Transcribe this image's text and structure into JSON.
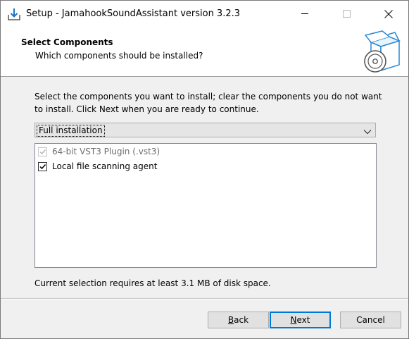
{
  "window": {
    "title": "Setup - JamahookSoundAssistant version 3.2.3",
    "icons": [
      "setup-download-icon",
      "minimize-icon",
      "maximize-icon",
      "close-icon"
    ]
  },
  "header": {
    "title": "Select Components",
    "subtitle": "Which components should be installed?",
    "icon": "software-box-disc-icon"
  },
  "body": {
    "description": "Select the components you want to install; clear the components you do not want to install. Click Next when you are ready to continue.",
    "install_type": {
      "selected": "Full installation"
    },
    "components": [
      {
        "label": "64-bit VST3 Plugin (.vst3)",
        "checked": true,
        "disabled": true
      },
      {
        "label": "Local file scanning agent",
        "checked": true,
        "disabled": false
      }
    ],
    "disk_space": "Current selection requires at least 3.1 MB of disk space."
  },
  "buttons": {
    "back_prefix": "",
    "back_access": "B",
    "back_rest": "ack",
    "next_access": "N",
    "next_rest": "ext",
    "cancel": "Cancel"
  },
  "colors": {
    "accent": "#0078d7",
    "background": "#f0f0f0"
  }
}
